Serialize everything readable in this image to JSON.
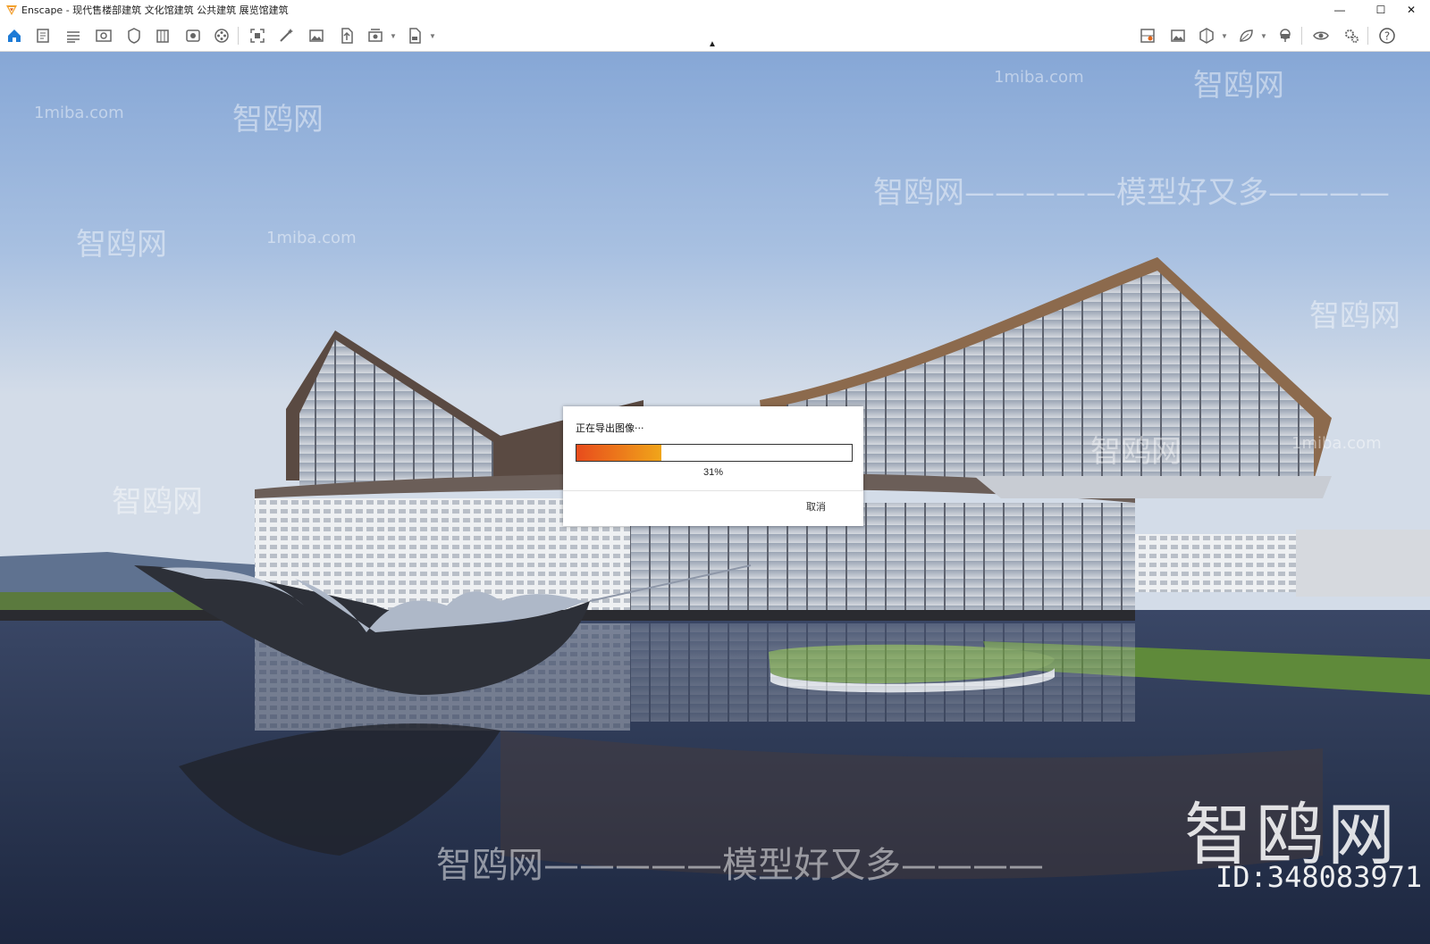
{
  "window": {
    "title": "Enscape - 现代售楼部建筑 文化馆建筑 公共建筑 展览馆建筑",
    "minimize_label": "—",
    "maximize_label": "☐",
    "close_label": "✕"
  },
  "colors": {
    "accent_blue": "#1e7bd6",
    "progress_start": "#e84c1c",
    "progress_end": "#f0a51a"
  },
  "toolbar": {
    "left_icons": [
      "home-icon",
      "document-icon",
      "bim-icon",
      "eye-view-icon",
      "shield-icon",
      "building-icon",
      "panorama-icon",
      "film-reel-icon",
      "capture-icon",
      "magic-wand-icon",
      "image-icon",
      "file-upload-icon",
      "batch-render-icon",
      "export-file-icon"
    ],
    "right_icons": [
      "map-pin-icon",
      "gallery-icon",
      "cube-icon",
      "leaf-icon",
      "vr-headset-icon",
      "visual-settings-icon",
      "settings-gear-icon",
      "help-icon"
    ]
  },
  "watermarks": {
    "site": "1miba.com",
    "brand": "智鸥网",
    "slogan": "智鸥网—————模型好又多————",
    "big_brand": "智鸥网",
    "id_label": "ID:348083971"
  },
  "export_dialog": {
    "title": "正在导出图像···",
    "progress_value": 31,
    "progress_label": "31%",
    "cancel_label": "取消"
  }
}
